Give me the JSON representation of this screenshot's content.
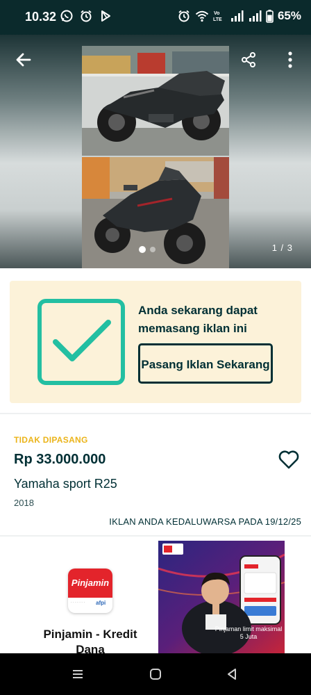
{
  "status_bar": {
    "time": "10.32",
    "left_icons": [
      "whatsapp-icon",
      "alarm-icon",
      "play-icon"
    ],
    "right_icons": [
      "alarm-icon",
      "wifi-icon",
      "volte-icon",
      "signal-icon",
      "signal-icon",
      "battery-icon"
    ],
    "volte_label": "Vo LTE",
    "battery": "65%"
  },
  "gallery": {
    "counter": "1 / 3",
    "current_index": 1,
    "total": 3
  },
  "promo": {
    "message": "Anda sekarang dapat memasang iklan ini",
    "button_label": "Pasang Iklan Sekarang",
    "accent_color": "#23bfa2",
    "background_color": "#fcf2d9"
  },
  "listing": {
    "status": "TIDAK DIPASANG",
    "status_color": "#ebb41a",
    "price": "Rp 33.000.000",
    "title": "Yamaha sport R25",
    "year": "2018",
    "expiry": "IKLAN ANDA KEDALUWARSA PADA 19/12/25"
  },
  "ad": {
    "logo_text": "Pinjamin",
    "logo_badge": "afpi",
    "title": "Pinjamin - Kredit Dana",
    "image_caption": "Pinjaman limit maksimal 5 Juta"
  },
  "nav_bar": {
    "icons": [
      "recents-icon",
      "home-icon",
      "back-icon"
    ]
  }
}
